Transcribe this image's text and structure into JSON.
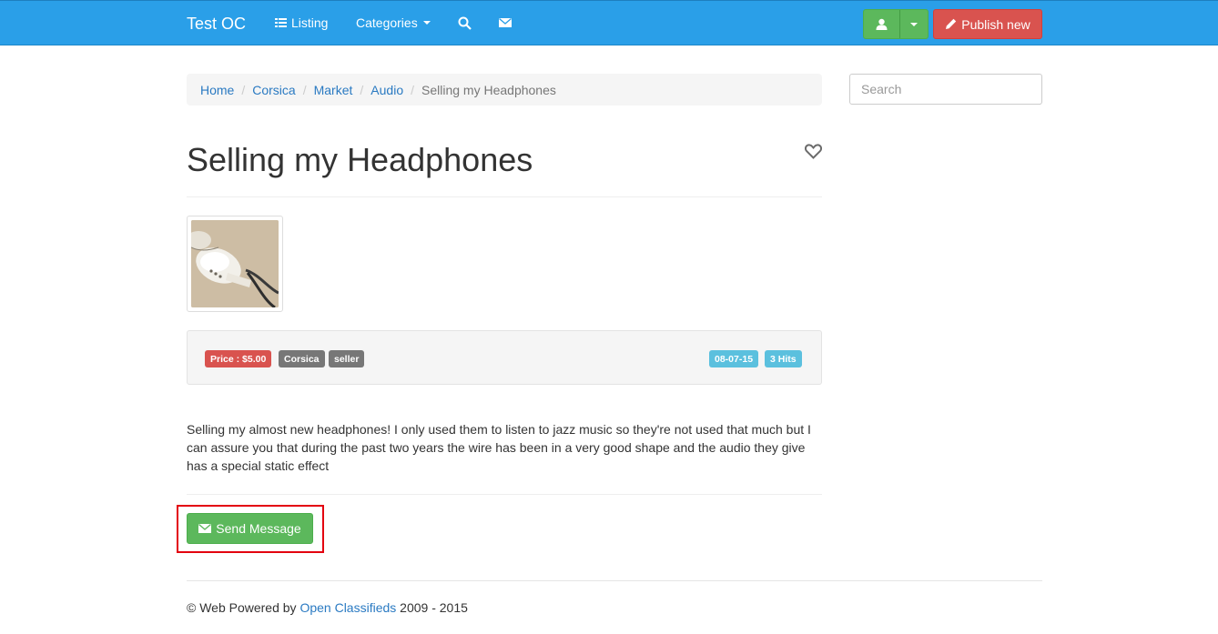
{
  "navbar": {
    "brand": "Test OC",
    "listing_label": "Listing",
    "categories_label": "Categories",
    "publish_label": "Publish new"
  },
  "breadcrumb": {
    "items": [
      "Home",
      "Corsica",
      "Market",
      "Audio"
    ],
    "active": "Selling my Headphones"
  },
  "search": {
    "placeholder": "Search"
  },
  "ad": {
    "title": "Selling my Headphones",
    "price": "Price : $5.00",
    "location": "Corsica",
    "user": "seller",
    "date": "08-07-15",
    "hits": "3 Hits",
    "description": "Selling my almost new headphones! I only used them to listen to jazz music so they're not used that much but I can assure you that during the past two years the wire has been in a very good shape and the audio they give has a special static effect",
    "send_label": "Send Message"
  },
  "footer": {
    "prefix": "© Web Powered by",
    "link": "Open Classifieds",
    "suffix": "2009 - 2015"
  },
  "colors": {
    "navbar": "#2a9fe8",
    "success": "#5cb85c",
    "danger": "#d9534f",
    "info": "#5bc0de",
    "highlight": "#e3000f"
  }
}
